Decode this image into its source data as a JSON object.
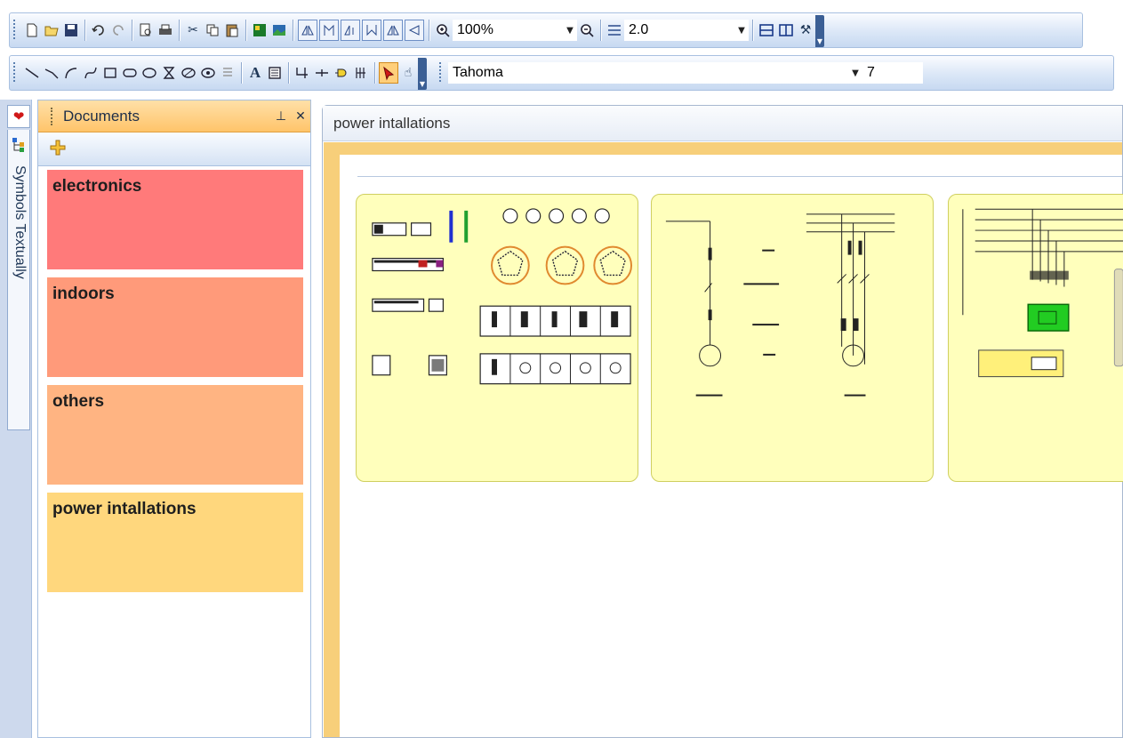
{
  "toolbar1": {
    "zoom_value": "100%",
    "line_width_value": "2.0"
  },
  "toolbar2": {
    "font_name": "Tahoma",
    "font_size": "7"
  },
  "left_tabs": {
    "symbols_label": "Symbols Textually"
  },
  "documents_panel": {
    "title": "Documents",
    "items": [
      {
        "label": "electronics",
        "color": "#ff7a7a"
      },
      {
        "label": "indoors",
        "color": "#ff9a7a"
      },
      {
        "label": "others",
        "color": "#ffb482"
      },
      {
        "label": "power intallations",
        "color": "#ffd77d"
      }
    ]
  },
  "document_window": {
    "title": "power intallations"
  }
}
